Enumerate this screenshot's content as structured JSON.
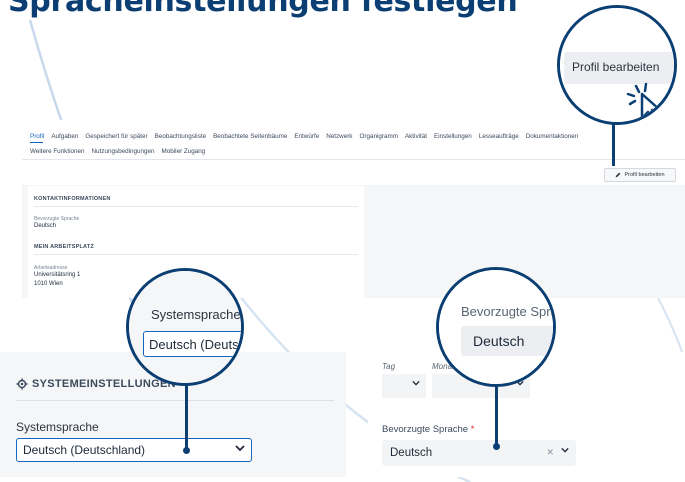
{
  "title": "Spracheinstellungen festlegen",
  "profile": {
    "tabs_row1": [
      "Profil",
      "Aufgaben",
      "Gespeichert für später",
      "Beobachtungsliste",
      "Beobachtete Seitenbäume",
      "Entwürfe",
      "Netzwerk",
      "Organigramm",
      "Aktivität",
      "Einstellungen",
      "Lesseaufträge",
      "Dokumentaktionen"
    ],
    "tabs_row2": [
      "Weitere Funktionen",
      "Nutzungsbedingungen",
      "Mobiler Zugang"
    ],
    "active_tab": "Profil",
    "edit_button_small": "Profil bearbeiten",
    "sections": {
      "contact_heading": "KONTAKTINFORMATIONEN",
      "pref_lang_label": "Bevorzugte Sprache",
      "pref_lang_value": "Deutsch",
      "workplace_heading": "MEIN ARBEITSPLATZ",
      "work_address_label": "Arbeitsadresse",
      "work_address_line1": "Universitätsring 1",
      "work_address_line2": "1010 Wien"
    }
  },
  "big_edit_button": "Profil bearbeiten",
  "system_settings": {
    "heading": "SYSTEMEINSTELLUNGEN",
    "label": "Systemsprache",
    "value": "Deutsch (Deutschland)"
  },
  "language_form": {
    "day_label": "Tag",
    "month_label": "Monat",
    "label": "Bevorzugte Sprache",
    "required_marker": "*",
    "value": "Deutsch"
  },
  "zoom_system": {
    "label": "Systemsprache",
    "value": "Deutsch (Deutschland)"
  },
  "zoom_language": {
    "label": "Bevorzugte Sprache",
    "value": "Deutsch"
  },
  "colors": {
    "title": "#0b3f73",
    "accent": "#1565c0",
    "circle": "#0b3f73",
    "required": "#d32f2f"
  },
  "icons": [
    "pencil-icon",
    "gear-icon",
    "chevron-down-icon",
    "clear-icon",
    "pointer-cursor-icon"
  ]
}
